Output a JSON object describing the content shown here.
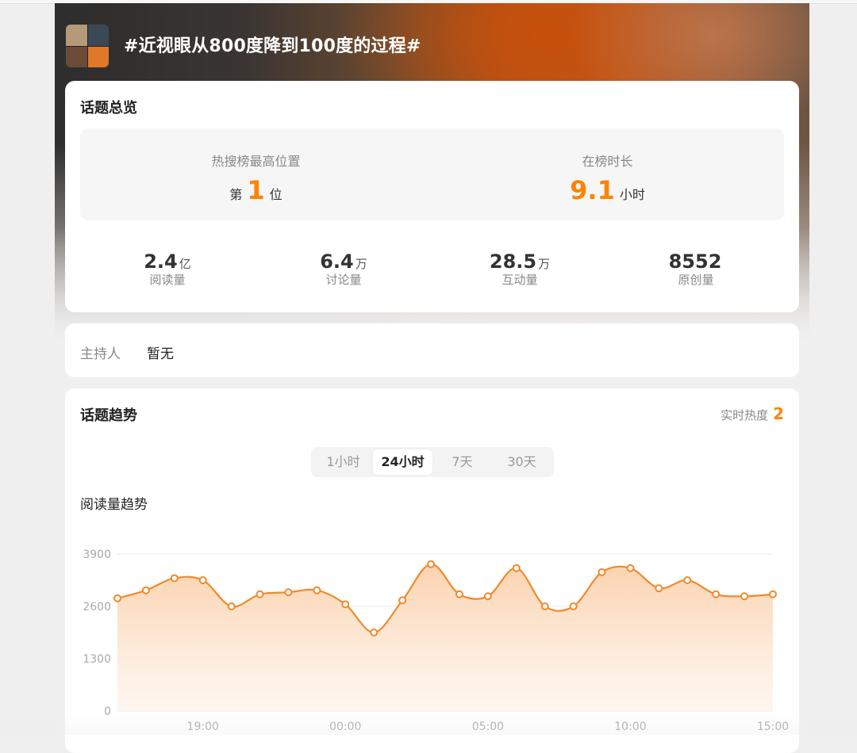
{
  "topic": {
    "title": "#近视眼从800度降到100度的过程#"
  },
  "overview": {
    "title": "话题总览",
    "rank_label": "热搜榜最高位置",
    "rank_prefix": "第",
    "rank_value": "1",
    "rank_suffix": "位",
    "duration_label": "在榜时长",
    "duration_value": "9.1",
    "duration_unit": "小时",
    "metrics": [
      {
        "value": "2.4",
        "unit": "亿",
        "label": "阅读量"
      },
      {
        "value": "6.4",
        "unit": "万",
        "label": "讨论量"
      },
      {
        "value": "28.5",
        "unit": "万",
        "label": "互动量"
      },
      {
        "value": "8552",
        "unit": "",
        "label": "原创量"
      }
    ]
  },
  "host": {
    "label": "主持人",
    "value": "暂无"
  },
  "trend": {
    "title": "话题趋势",
    "heat_label": "实时热度",
    "heat_value": "2",
    "tabs": [
      "1小时",
      "24小时",
      "7天",
      "30天"
    ],
    "active_tab": "24小时",
    "chart_title": "阅读量趋势"
  },
  "colors": {
    "accent": "#ff8200",
    "line": "#f08a2c",
    "fill_top": "#fbd3b0"
  },
  "chart_data": {
    "type": "area",
    "title": "阅读量趋势",
    "ylim": [
      0,
      3900
    ],
    "yticks": [
      "3900",
      "2600",
      "1300",
      "0"
    ],
    "ytick_values": [
      3900,
      2600,
      1300,
      0
    ],
    "xticks": [
      "19:00",
      "00:00",
      "05:00",
      "10:00",
      "15:00"
    ],
    "x_tick_indexes": [
      3,
      8,
      13,
      18,
      23
    ],
    "grid": true,
    "series": [
      {
        "values": [
          2800,
          3000,
          3300,
          3250,
          2600,
          2900,
          2950,
          3000,
          2650,
          1950,
          2750,
          3650,
          2900,
          2850,
          3550,
          2600,
          2600,
          3450,
          3550,
          3050,
          3250,
          2900,
          2850,
          2900
        ]
      }
    ]
  }
}
